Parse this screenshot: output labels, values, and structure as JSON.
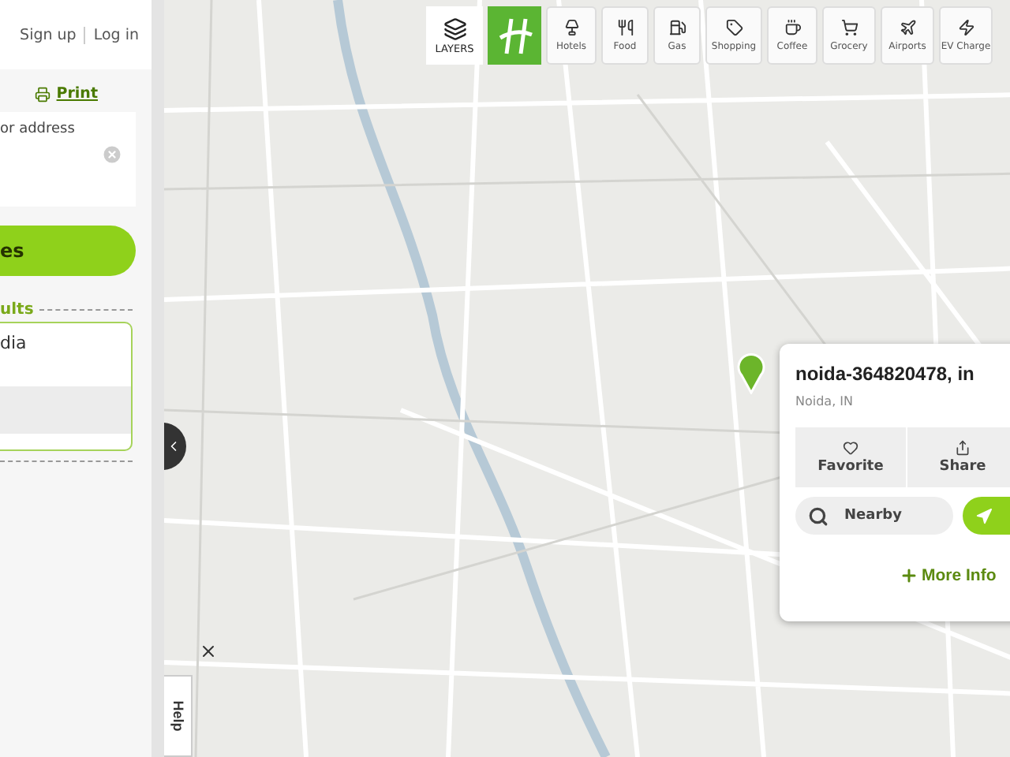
{
  "header": {
    "links": [
      "Sign up",
      "Log in"
    ]
  },
  "print_link": "Print",
  "search": {
    "placeholder": "or address"
  },
  "search_button": "es",
  "results": {
    "heading": "ults",
    "items": [
      {
        "label": "dia"
      }
    ]
  },
  "toolbar": {
    "layers_label": "LAYERS",
    "categories": [
      {
        "label": "Hotels"
      },
      {
        "label": "Food"
      },
      {
        "label": "Gas"
      },
      {
        "label": "Shopping"
      },
      {
        "label": "Coffee"
      },
      {
        "label": "Grocery"
      },
      {
        "label": "Airports"
      },
      {
        "label": "EV Charge"
      }
    ]
  },
  "popup": {
    "title": "noida-364820478, in",
    "subtitle": "Noida, IN",
    "actions": [
      {
        "label": "Favorite"
      },
      {
        "label": "Share"
      }
    ],
    "nearby": "Nearby",
    "more": "More Info"
  },
  "help_tab": "Help"
}
